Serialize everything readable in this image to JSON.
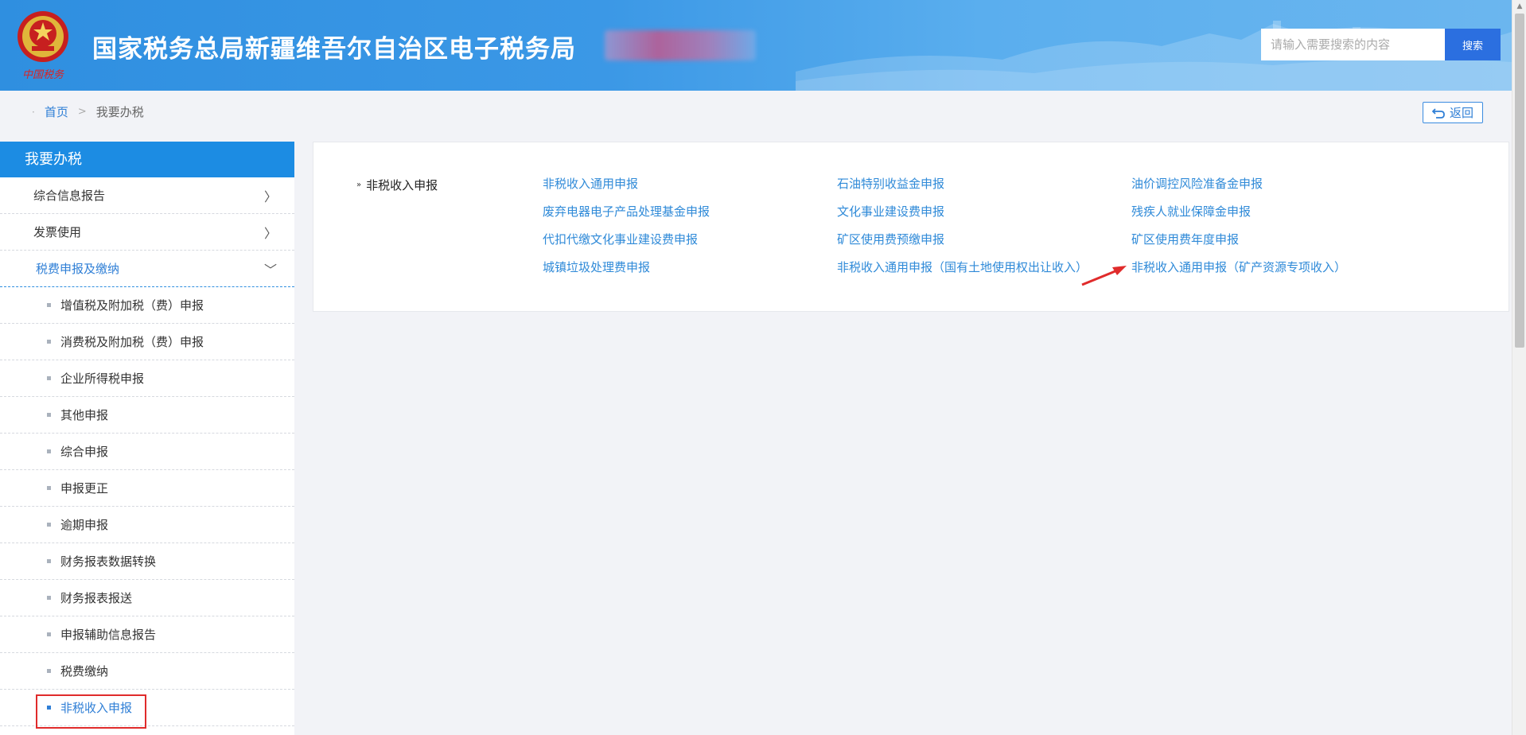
{
  "header": {
    "site_title": "国家税务总局新疆维吾尔自治区电子税务局",
    "search_placeholder": "请输入需要搜索的内容",
    "search_button": "搜索",
    "emblem_text": "中国税务"
  },
  "breadcrumb": {
    "home": "首页",
    "separator": ">",
    "current": "我要办税"
  },
  "back_button": "返回",
  "sidebar": {
    "title": "我要办税",
    "menu": [
      {
        "label": "综合信息报告",
        "chevron": "〉"
      },
      {
        "label": "发票使用",
        "chevron": "〉"
      },
      {
        "label": "税费申报及缴纳",
        "chevron": "﹀"
      }
    ],
    "sub_items": [
      "增值税及附加税（费）申报",
      "消费税及附加税（费）申报",
      "企业所得税申报",
      "其他申报",
      "综合申报",
      "申报更正",
      "逾期申报",
      "财务报表数据转换",
      "财务报表报送",
      "申报辅助信息报告",
      "税费缴纳",
      "非税收入申报"
    ]
  },
  "panel": {
    "category": "非税收入申报",
    "links": [
      "非税收入通用申报",
      "石油特别收益金申报",
      "油价调控风险准备金申报",
      "废弃电器电子产品处理基金申报",
      "文化事业建设费申报",
      "残疾人就业保障金申报",
      "代扣代缴文化事业建设费申报",
      "矿区使用费预缴申报",
      "矿区使用费年度申报",
      "城镇垃圾处理费申报",
      "非税收入通用申报（国有土地使用权出让收入）",
      "非税收入通用申报（矿产资源专项收入）"
    ]
  },
  "colors": {
    "header_blue": "#2f8fe0",
    "sidebar_head": "#1c8ce3",
    "link_blue": "#2f8ad8",
    "highlight_red": "#e02b2b"
  }
}
